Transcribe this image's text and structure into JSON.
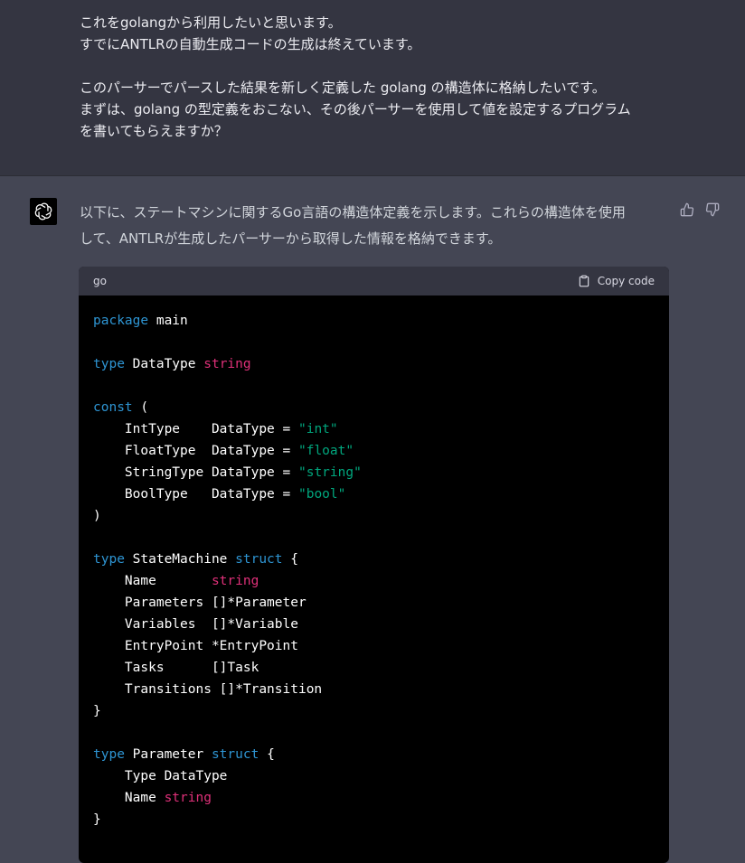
{
  "user_message": {
    "lines": [
      "これをgolangから利用したいと思います。",
      "すでにANTLRの自動生成コードの生成は終えています。",
      "",
      "このパーサーでパースした結果を新しく定義した golang の構造体に格納したいです。",
      "まずは、golang の型定義をおこない、その後パーサーを使用して値を設定するプログラム",
      "を書いてもらえますか？"
    ]
  },
  "assistant_message": {
    "intro_lines": [
      "以下に、ステートマシンに関するGo言語の構造体定義を示します。これらの構造体を使用",
      "して、ANTLRが生成したパーサーから取得した情報を格納できます。"
    ],
    "code_block": {
      "language": "go",
      "copy_label": "Copy code",
      "lines": [
        [
          {
            "t": "package",
            "c": "kw"
          },
          {
            "t": " main"
          }
        ],
        [],
        [
          {
            "t": "type",
            "c": "kw"
          },
          {
            "t": " DataType "
          },
          {
            "t": "string",
            "c": "ty"
          }
        ],
        [],
        [
          {
            "t": "const",
            "c": "kw"
          },
          {
            "t": " ("
          }
        ],
        [
          {
            "t": "    IntType    DataType = "
          },
          {
            "t": "\"int\"",
            "c": "st"
          }
        ],
        [
          {
            "t": "    FloatType  DataType = "
          },
          {
            "t": "\"float\"",
            "c": "st"
          }
        ],
        [
          {
            "t": "    StringType DataType = "
          },
          {
            "t": "\"string\"",
            "c": "st"
          }
        ],
        [
          {
            "t": "    BoolType   DataType = "
          },
          {
            "t": "\"bool\"",
            "c": "st"
          }
        ],
        [
          {
            "t": ")"
          }
        ],
        [],
        [
          {
            "t": "type",
            "c": "kw"
          },
          {
            "t": " StateMachine "
          },
          {
            "t": "struct",
            "c": "kw"
          },
          {
            "t": " {"
          }
        ],
        [
          {
            "t": "    Name       "
          },
          {
            "t": "string",
            "c": "ty"
          }
        ],
        [
          {
            "t": "    Parameters []*Parameter"
          }
        ],
        [
          {
            "t": "    Variables  []*Variable"
          }
        ],
        [
          {
            "t": "    EntryPoint *EntryPoint"
          }
        ],
        [
          {
            "t": "    Tasks      []Task"
          }
        ],
        [
          {
            "t": "    Transitions []*Transition"
          }
        ],
        [
          {
            "t": "}"
          }
        ],
        [],
        [
          {
            "t": "type",
            "c": "kw"
          },
          {
            "t": " Parameter "
          },
          {
            "t": "struct",
            "c": "kw"
          },
          {
            "t": " {"
          }
        ],
        [
          {
            "t": "    Type DataType"
          }
        ],
        [
          {
            "t": "    Name "
          },
          {
            "t": "string",
            "c": "ty"
          }
        ],
        [
          {
            "t": "}"
          }
        ]
      ]
    }
  },
  "colors": {
    "user_bg": "#343541",
    "assistant_bg": "#444654",
    "keyword": "#2e95d3",
    "type": "#df3079",
    "string": "#00a67d"
  },
  "icons": {
    "avatar": "openai-logo-icon",
    "thumbs_up": "thumbs-up-icon",
    "thumbs_down": "thumbs-down-icon",
    "copy": "clipboard-icon"
  }
}
